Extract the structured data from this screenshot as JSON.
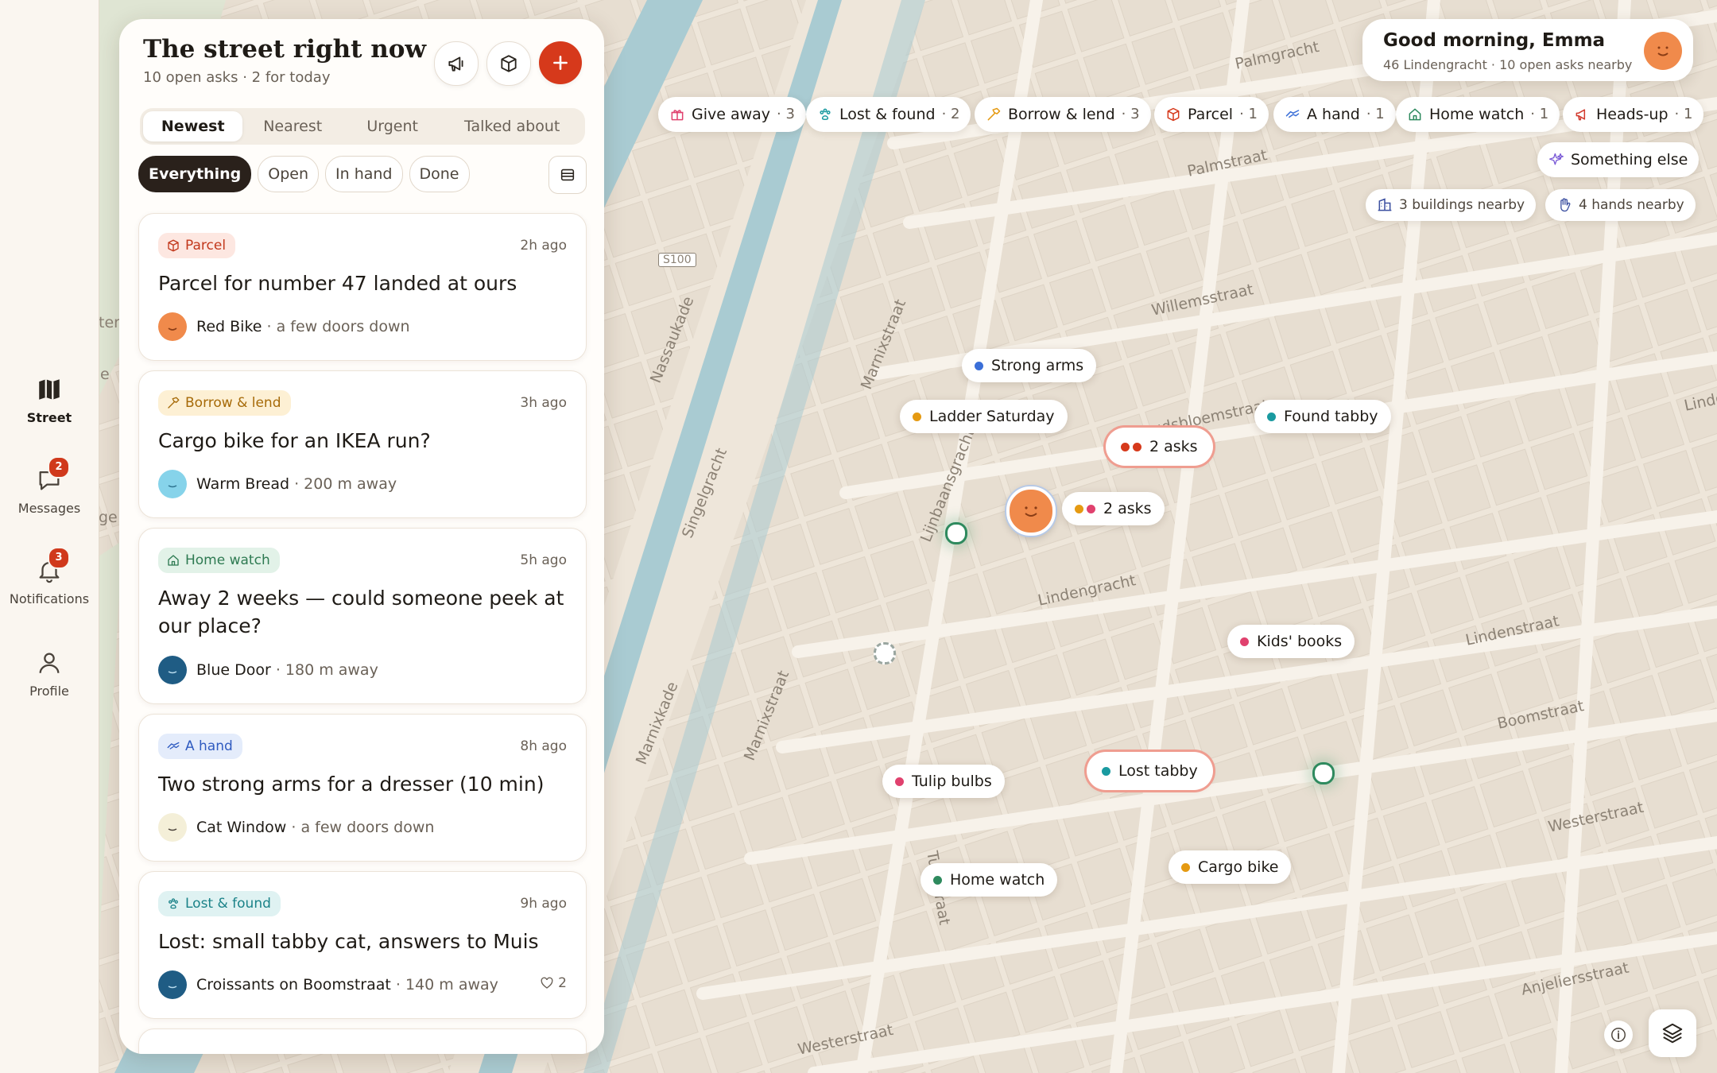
{
  "rail": {
    "items": [
      {
        "label": "Street",
        "icon": "map-icon"
      },
      {
        "label": "Messages",
        "icon": "chat-icon",
        "badge": "2"
      },
      {
        "label": "Notifications",
        "icon": "bell-icon",
        "badge": "3"
      },
      {
        "label": "Profile",
        "icon": "person-icon"
      }
    ]
  },
  "feed": {
    "title": "The street right now",
    "subtitle": "10 open asks · 2 for today",
    "sort_tabs": [
      "Newest",
      "Nearest",
      "Urgent",
      "Talked about"
    ],
    "active_sort": "Newest",
    "filters": [
      "Everything",
      "Open",
      "In hand",
      "Done"
    ],
    "active_filter": "Everything",
    "cards": [
      {
        "tag": "Parcel",
        "time": "2h ago",
        "title": "Parcel for number 47 landed at ours",
        "name": "Red Bike",
        "dist": " · a few doors down"
      },
      {
        "tag": "Borrow & lend",
        "time": "3h ago",
        "title": "Cargo bike for an IKEA run?",
        "name": "Warm Bread",
        "dist": " · 200 m away"
      },
      {
        "tag": "Home watch",
        "time": "5h ago",
        "title": "Away 2 weeks — could someone peek at our place?",
        "name": "Blue Door",
        "dist": " · 180 m away"
      },
      {
        "tag": "A hand",
        "time": "8h ago",
        "title": "Two strong arms for a dresser (10 min)",
        "name": "Cat Window",
        "dist": " · a few doors down"
      },
      {
        "tag": "Lost & found",
        "time": "9h ago",
        "title": "Lost: small tabby cat, answers to Muis",
        "name": "Croissants on Boomstraat",
        "dist": " · 140 m away",
        "likes": "2"
      }
    ]
  },
  "greeting": {
    "title": "Good morning, Emma",
    "subtitle": "46 Lindengracht · 10 open asks nearby"
  },
  "categories": [
    {
      "label": "Give away",
      "count": "· 3",
      "color": "#e0416e"
    },
    {
      "label": "Lost & found",
      "count": "· 2",
      "color": "#1a9aa0"
    },
    {
      "label": "Borrow & lend",
      "count": "· 3",
      "color": "#e59a12"
    },
    {
      "label": "Parcel",
      "count": "· 1",
      "color": "#d6391b"
    },
    {
      "label": "A hand",
      "count": "· 1",
      "color": "#3b6fd8"
    },
    {
      "label": "Home watch",
      "count": "· 1",
      "color": "#2e8a5e"
    },
    {
      "label": "Heads-up",
      "count": "· 1",
      "color": "#d23a2e"
    },
    {
      "label": "Something else",
      "count": "",
      "color": "#7a5ad6"
    }
  ],
  "nearby": {
    "buildings": "3 buildings nearby",
    "hands": "4 hands nearby"
  },
  "pins": [
    {
      "label": "Strong arms",
      "color": "#3b6fd8"
    },
    {
      "label": "Ladder Saturday",
      "color": "#e59a12"
    },
    {
      "label": "Found tabby",
      "color": "#1a9aa0"
    },
    {
      "label": "2 asks",
      "color": "#d6391b"
    },
    {
      "label": "2 asks",
      "color": "#e59a12"
    },
    {
      "label": "Kids' books",
      "color": "#e0416e"
    },
    {
      "label": "Lost tabby",
      "color": "#1a9aa0"
    },
    {
      "label": "Tulip bulbs",
      "color": "#e0416e"
    },
    {
      "label": "Home watch",
      "color": "#2e8a5e"
    },
    {
      "label": "Cargo bike",
      "color": "#e59a12"
    }
  ],
  "streets": [
    "Palmgracht",
    "Palmstraat",
    "Willemsstraat",
    "Goudsbloemstraat",
    "Lindengracht",
    "Lindenstraat",
    "Boomstraat",
    "Westerstraat",
    "Anjeliersstraat",
    "Westerstraat",
    "Marnixstraat",
    "Marnixstraat",
    "Marnixkade",
    "Nassaukade",
    "Singelgracht",
    "Lijnbaansgracht",
    "Tuinstraat",
    "S100",
    "Linde",
    "ter",
    "ge",
    "e"
  ]
}
